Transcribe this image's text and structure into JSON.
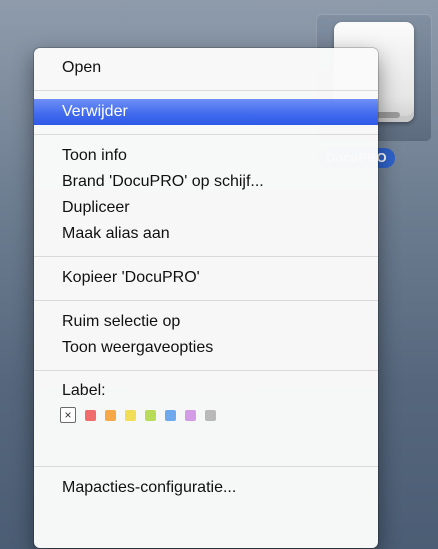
{
  "desktop": {
    "drive_label": "DocuPRO"
  },
  "menu": {
    "groups": [
      {
        "items": [
          {
            "label": "Open"
          }
        ]
      },
      {
        "items": [
          {
            "label": "Verwijder",
            "selected": true
          },
          {
            "label": "Toon info"
          },
          {
            "label": "Brand 'DocuPRO' op schijf..."
          },
          {
            "label": "Dupliceer"
          },
          {
            "label": "Maak alias aan"
          }
        ]
      },
      {
        "items": [
          {
            "label": "Kopieer 'DocuPRO'"
          }
        ]
      },
      {
        "items": [
          {
            "label": "Ruim selectie op"
          },
          {
            "label": "Toon weergaveopties"
          }
        ]
      }
    ],
    "label_section": {
      "heading": "Label:",
      "none_glyph": "×",
      "colors": [
        "#f06b6b",
        "#f5a845",
        "#f2dd57",
        "#b8dc5a",
        "#6ea9ee",
        "#d49be6",
        "#b9b9b9"
      ]
    },
    "footer": {
      "label": "Mapacties-configuratie..."
    }
  },
  "colors": {
    "selection": "#3f69ee",
    "drive_label_bg": "#2e62c9"
  }
}
